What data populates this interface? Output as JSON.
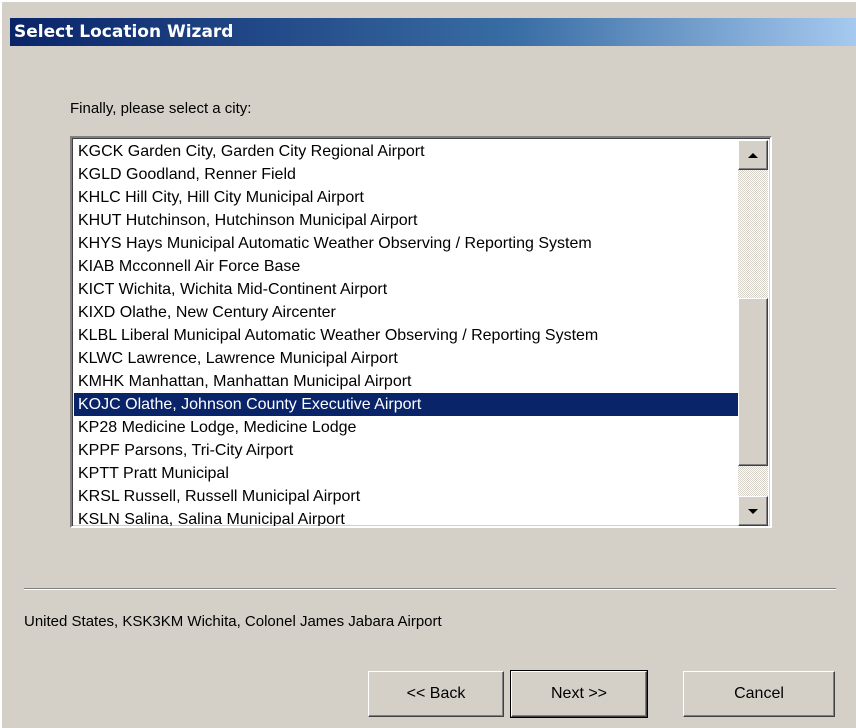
{
  "window": {
    "title": "Select Location Wizard"
  },
  "prompt": "Finally, please select a city:",
  "list": {
    "items": [
      "KGCK Garden City, Garden City Regional Airport",
      "KGLD Goodland, Renner Field",
      "KHLC Hill City, Hill City Municipal Airport",
      "KHUT Hutchinson, Hutchinson Municipal Airport",
      "KHYS Hays Municipal Automatic Weather Observing / Reporting System",
      "KIAB Mcconnell Air Force Base",
      "KICT Wichita, Wichita Mid-Continent Airport",
      "KIXD Olathe, New Century Aircenter",
      "KLBL Liberal Municipal Automatic Weather Observing / Reporting System",
      "KLWC Lawrence, Lawrence Municipal Airport",
      "KMHK Manhattan, Manhattan Municipal Airport",
      "KOJC Olathe, Johnson County Executive Airport",
      "KP28 Medicine Lodge, Medicine Lodge",
      "KPPF Parsons, Tri-City Airport",
      "KPTT Pratt Municipal",
      "KRSL Russell, Russell Municipal Airport",
      "KSLN Salina, Salina Municipal Airport"
    ],
    "selected_index": 11
  },
  "status_text": "United States, KSK3KM Wichita, Colonel James Jabara Airport",
  "buttons": {
    "back": "<< Back",
    "next": "Next >>",
    "cancel": "Cancel"
  },
  "colors": {
    "selection": "#0a246a",
    "dialog_bg": "#d4d0c8"
  }
}
